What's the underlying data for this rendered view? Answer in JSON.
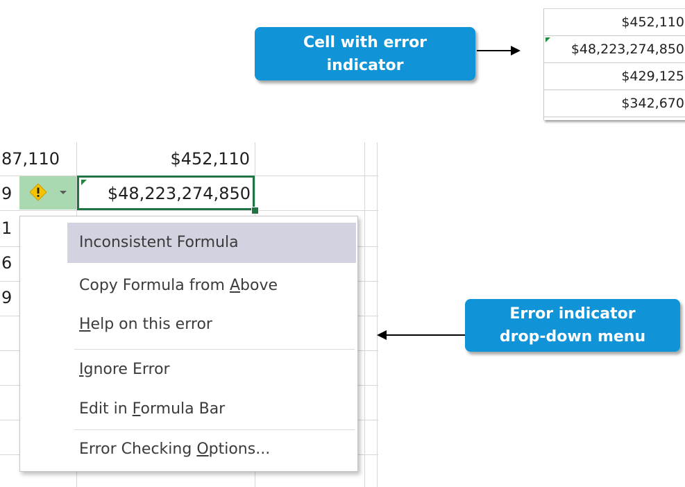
{
  "callouts": {
    "cell_with_error": [
      "Cell with error",
      "indicator"
    ],
    "dropdown_menu": [
      "Error indicator",
      "drop-down menu"
    ]
  },
  "mini_table": {
    "rows": [
      "$452,110",
      "$48,223,274,850",
      "$429,125",
      "$342,670"
    ],
    "error_row_index": 1
  },
  "spreadsheet": {
    "row1": {
      "col_a_partial": "87,110",
      "col_b": "$452,110"
    },
    "row2": {
      "col_a_partial": "9",
      "col_b": "$48,223,274,850"
    },
    "left_partial_values": [
      "1",
      "6",
      "9"
    ]
  },
  "icons": {
    "warning": "warning-icon",
    "dropdown": "chevron-down-icon"
  },
  "menu": {
    "items": [
      {
        "pre": "Inconsistent Formula",
        "key": "",
        "post": "",
        "highlighted": true,
        "interactive": false
      },
      {
        "pre": "Copy Formula from ",
        "key": "A",
        "post": "bove",
        "highlighted": false,
        "interactive": true
      },
      {
        "pre": "",
        "key": "H",
        "post": "elp on this error",
        "highlighted": false,
        "interactive": true
      },
      {
        "pre": "",
        "key": "I",
        "post": "gnore Error",
        "highlighted": false,
        "interactive": true
      },
      {
        "pre": "Edit in ",
        "key": "F",
        "post": "ormula Bar",
        "highlighted": false,
        "interactive": true
      },
      {
        "pre": "Error Checking ",
        "key": "O",
        "post": "ptions...",
        "highlighted": false,
        "interactive": true
      }
    ]
  },
  "colors": {
    "callout_bg": "#1193d8",
    "selection_border": "#217346",
    "error_triangle": "#1e8a3c",
    "icon_area_bg": "#a9d8b1",
    "menu_highlight": "#d2d2e0",
    "warning_fill": "#f5c400"
  }
}
